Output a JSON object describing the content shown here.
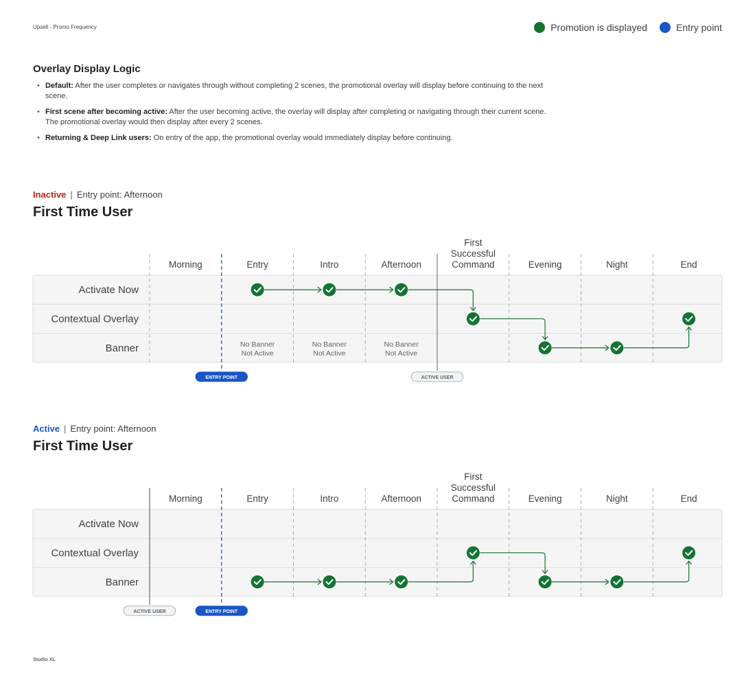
{
  "document_title": "Upsell - Promo Frequency",
  "footer": "Studio XL",
  "legend": [
    {
      "label": "Promotion is displayed",
      "color": "#137333"
    },
    {
      "label": "Entry point",
      "color": "#1a56c4"
    }
  ],
  "logic": {
    "title": "Overlay Display Logic",
    "bullets": [
      {
        "bold": "Default:",
        "text": " After the user completes or navigates through without completing 2 scenes, the promotional overlay will display before continuing to the next scene."
      },
      {
        "bold": "First scene after becoming active:",
        "text": " After the user becoming active, the overlay will display after completing or navigating through their current scene. The promotional overlay would then display after every 2 scenes."
      },
      {
        "bold": "Returning & Deep Link users:",
        "text": " On entry of the app, the promotional overlay would immediately display before continuing."
      }
    ]
  },
  "colors": {
    "green": "#137333",
    "blue": "#1a56c4",
    "inactive_red": "#b3261e",
    "active_blue": "#1a56c4",
    "grid_bg": "#f5f5f5",
    "divider": "#9aa0a6"
  },
  "columns": [
    "Morning",
    "Entry",
    "Intro",
    "Afternoon",
    "First Successful Command",
    "Evening",
    "Night",
    "End"
  ],
  "rows": [
    "Activate Now",
    "Contextual Overlay",
    "Banner"
  ],
  "diagrams": [
    {
      "id": "inactive",
      "state": "Inactive",
      "state_color": "#b3261e",
      "entry_label": "Entry point: Afternoon",
      "title": "First Time User",
      "entry_point_tag": "ENTRY POINT",
      "active_user_tag": "ACTIVE USER",
      "entry_point_after_column": 0,
      "active_user_after_column": 3,
      "checks": [
        {
          "row": 0,
          "col": 1
        },
        {
          "row": 0,
          "col": 2
        },
        {
          "row": 0,
          "col": 3
        },
        {
          "row": 1,
          "col": 4
        },
        {
          "row": 1,
          "col": 7
        },
        {
          "row": 2,
          "col": 5
        },
        {
          "row": 2,
          "col": 6
        }
      ],
      "notes": [
        {
          "row": 2,
          "col": 1,
          "lines": [
            "No Banner",
            "Not Active"
          ]
        },
        {
          "row": 2,
          "col": 2,
          "lines": [
            "No Banner",
            "Not Active"
          ]
        },
        {
          "row": 2,
          "col": 3,
          "lines": [
            "No Banner",
            "Not Active"
          ]
        }
      ],
      "path": [
        [
          0,
          1
        ],
        [
          0,
          2
        ],
        [
          0,
          3
        ],
        [
          1,
          4
        ],
        [
          2,
          5
        ],
        [
          2,
          6
        ],
        [
          1,
          7
        ]
      ]
    },
    {
      "id": "active",
      "state": "Active",
      "state_color": "#1a56c4",
      "entry_label": "Entry point: Afternoon",
      "title": "First Time User",
      "entry_point_tag": "ENTRY POINT",
      "active_user_tag": "ACTIVE USER",
      "entry_point_after_column": 0,
      "active_user_after_column": -1,
      "checks": [
        {
          "row": 2,
          "col": 1
        },
        {
          "row": 2,
          "col": 2
        },
        {
          "row": 2,
          "col": 3
        },
        {
          "row": 1,
          "col": 4
        },
        {
          "row": 1,
          "col": 7
        },
        {
          "row": 2,
          "col": 5
        },
        {
          "row": 2,
          "col": 6
        }
      ],
      "notes": [],
      "path": [
        [
          2,
          1
        ],
        [
          2,
          2
        ],
        [
          2,
          3
        ],
        [
          1,
          4
        ],
        [
          2,
          5
        ],
        [
          2,
          6
        ],
        [
          1,
          7
        ]
      ]
    }
  ]
}
